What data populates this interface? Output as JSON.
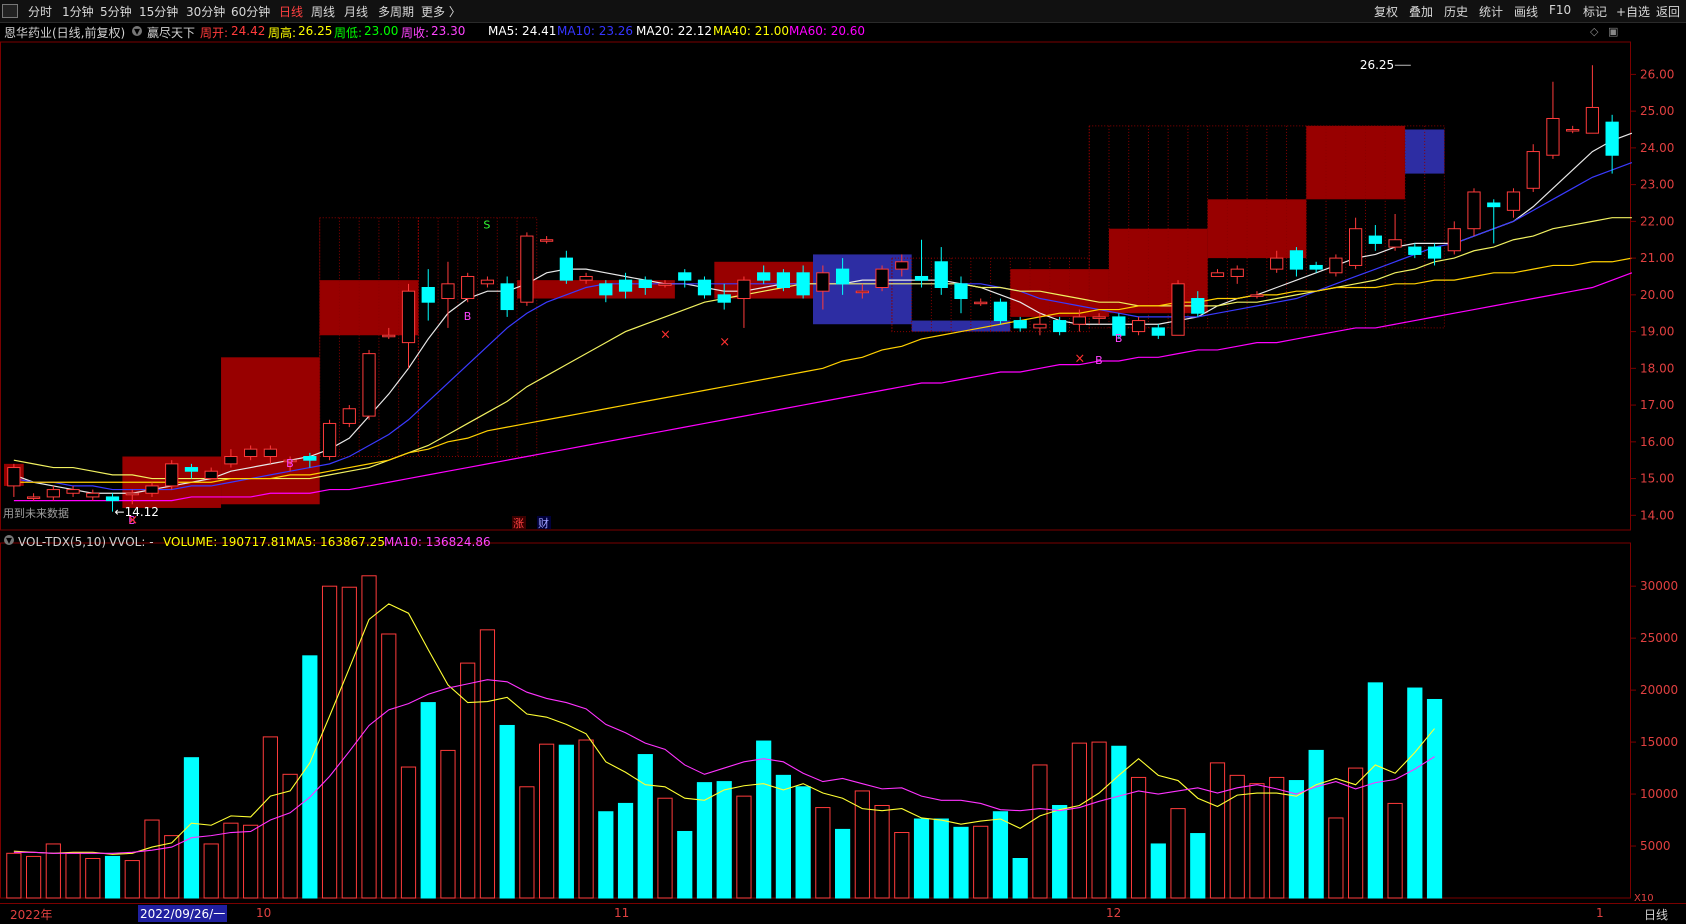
{
  "toolbar": {
    "periods": [
      "分时",
      "1分钟",
      "5分钟",
      "15分钟",
      "30分钟",
      "60分钟",
      "日线",
      "周线",
      "月线",
      "多周期",
      "更多 〉"
    ],
    "active_period": "日线",
    "right_buttons": [
      "复权",
      "叠加",
      "历史",
      "统计",
      "画线",
      "F10",
      "标记",
      "+自选",
      "返回"
    ]
  },
  "info": {
    "stock": "恩华药业(日线,前复权)",
    "indicator": "赢尽天下",
    "week_open_label": "周开:",
    "week_open": "24.42",
    "week_high_label": "周高:",
    "week_high": "26.25",
    "week_low_label": "周低:",
    "week_low": "23.00",
    "week_close_label": "周收:",
    "week_close": "23.30",
    "ma5": "MA5: 24.41",
    "ma10": "MA10: 23.26",
    "ma20": "MA20: 22.12",
    "ma40": "MA40: 21.00",
    "ma60": "MA60: 20.60"
  },
  "main_chart": {
    "y_ticks": [
      "26.00",
      "25.00",
      "24.00",
      "23.00",
      "22.00",
      "21.00",
      "20.00",
      "19.00",
      "18.00",
      "17.00",
      "16.00",
      "15.00",
      "14.00"
    ],
    "ymin": 13.6,
    "ymax": 26.8,
    "high_annotation": "26.25",
    "low_annotation": "←14.12",
    "future_data_note": "用到未来数据",
    "markers": [
      "涨",
      "财"
    ],
    "signals": {
      "buy": "B",
      "sell": "S",
      "cross": "×"
    },
    "candles": [
      [
        14.8,
        15.3,
        14.5,
        15.4
      ],
      [
        14.5,
        14.5,
        14.4,
        14.6
      ],
      [
        14.5,
        14.7,
        14.4,
        14.8
      ],
      [
        14.6,
        14.7,
        14.5,
        14.8
      ],
      [
        14.5,
        14.6,
        14.4,
        14.7
      ],
      [
        14.5,
        14.4,
        14.1,
        14.6
      ],
      [
        14.6,
        14.6,
        14.3,
        14.7
      ],
      [
        14.6,
        14.8,
        14.5,
        14.9
      ],
      [
        14.8,
        15.4,
        14.7,
        15.5
      ],
      [
        15.3,
        15.2,
        15.0,
        15.4
      ],
      [
        15.0,
        15.2,
        15.0,
        15.3
      ],
      [
        15.4,
        15.6,
        15.3,
        15.8
      ],
      [
        15.6,
        15.8,
        15.5,
        15.9
      ],
      [
        15.6,
        15.8,
        15.4,
        15.9
      ],
      [
        15.5,
        15.5,
        15.2,
        15.6
      ],
      [
        15.6,
        15.5,
        15.3,
        15.7
      ],
      [
        15.6,
        16.5,
        15.5,
        16.6
      ],
      [
        16.5,
        16.9,
        16.4,
        17.0
      ],
      [
        16.7,
        18.4,
        16.6,
        18.5
      ],
      [
        18.9,
        18.9,
        18.8,
        19.1
      ],
      [
        18.7,
        20.1,
        18.0,
        20.3
      ],
      [
        20.2,
        19.8,
        19.3,
        20.7
      ],
      [
        19.9,
        20.3,
        19.1,
        20.9
      ],
      [
        19.9,
        20.5,
        19.8,
        20.6
      ],
      [
        20.3,
        20.4,
        20.2,
        20.5
      ],
      [
        20.3,
        19.6,
        19.4,
        20.5
      ],
      [
        19.8,
        21.6,
        19.7,
        21.7
      ],
      [
        21.5,
        21.5,
        21.4,
        21.6
      ],
      [
        21.0,
        20.4,
        20.3,
        21.2
      ],
      [
        20.4,
        20.5,
        20.3,
        20.6
      ],
      [
        20.3,
        20.0,
        19.8,
        20.4
      ],
      [
        20.4,
        20.1,
        19.9,
        20.6
      ],
      [
        20.4,
        20.2,
        20.0,
        20.5
      ],
      [
        20.3,
        20.3,
        20.2,
        20.4
      ],
      [
        20.6,
        20.4,
        20.2,
        20.7
      ],
      [
        20.4,
        20.0,
        19.9,
        20.5
      ],
      [
        20.0,
        19.8,
        19.6,
        20.3
      ],
      [
        19.9,
        20.4,
        19.1,
        20.5
      ],
      [
        20.6,
        20.4,
        20.3,
        20.8
      ],
      [
        20.6,
        20.2,
        20.1,
        20.7
      ],
      [
        20.6,
        20.0,
        19.9,
        20.8
      ],
      [
        20.1,
        20.6,
        19.6,
        20.8
      ],
      [
        20.7,
        20.3,
        20.0,
        21.0
      ],
      [
        20.1,
        20.1,
        19.9,
        20.3
      ],
      [
        20.2,
        20.7,
        20.1,
        20.8
      ],
      [
        20.7,
        20.9,
        20.5,
        21.1
      ],
      [
        20.5,
        20.4,
        20.2,
        21.5
      ],
      [
        20.9,
        20.2,
        20.0,
        21.3
      ],
      [
        20.3,
        19.9,
        19.5,
        20.5
      ],
      [
        19.8,
        19.8,
        19.7,
        19.9
      ],
      [
        19.8,
        19.3,
        19.2,
        19.9
      ],
      [
        19.3,
        19.1,
        19.0,
        19.4
      ],
      [
        19.1,
        19.2,
        18.9,
        19.5
      ],
      [
        19.3,
        19.0,
        18.9,
        19.4
      ],
      [
        19.2,
        19.4,
        19.0,
        19.6
      ],
      [
        19.4,
        19.4,
        19.2,
        19.5
      ],
      [
        19.4,
        18.9,
        18.8,
        19.5
      ],
      [
        19.0,
        19.3,
        18.9,
        19.4
      ],
      [
        19.1,
        18.9,
        18.8,
        19.2
      ],
      [
        18.9,
        20.3,
        18.9,
        20.4
      ],
      [
        19.9,
        19.5,
        19.4,
        20.1
      ],
      [
        20.5,
        20.6,
        20.5,
        20.7
      ],
      [
        20.5,
        20.7,
        20.3,
        20.8
      ],
      [
        20.0,
        20.0,
        19.9,
        20.1
      ],
      [
        20.7,
        21.0,
        20.6,
        21.2
      ],
      [
        21.2,
        20.7,
        20.5,
        21.3
      ],
      [
        20.8,
        20.7,
        20.6,
        20.9
      ],
      [
        20.6,
        21.0,
        20.5,
        21.1
      ],
      [
        20.8,
        21.8,
        20.7,
        22.1
      ],
      [
        21.6,
        21.4,
        21.2,
        21.9
      ],
      [
        21.3,
        21.5,
        21.2,
        22.2
      ],
      [
        21.3,
        21.1,
        21.0,
        21.4
      ],
      [
        21.3,
        21.0,
        20.8,
        21.4
      ],
      [
        21.2,
        21.8,
        21.1,
        22.0
      ],
      [
        21.8,
        22.8,
        21.6,
        22.9
      ],
      [
        22.5,
        22.4,
        21.4,
        22.6
      ],
      [
        22.3,
        22.8,
        22.1,
        22.9
      ],
      [
        22.9,
        23.9,
        22.8,
        24.1
      ],
      [
        23.8,
        24.8,
        23.7,
        25.8
      ],
      [
        24.5,
        24.5,
        24.4,
        24.6
      ],
      [
        24.4,
        25.1,
        24.4,
        26.25
      ],
      [
        24.7,
        23.8,
        23.3,
        24.9
      ]
    ],
    "ma_lines": {
      "ma5": [
        15.1,
        14.9,
        14.8,
        14.7,
        14.6,
        14.6,
        14.6,
        14.7,
        14.8,
        14.9,
        15.0,
        15.2,
        15.3,
        15.4,
        15.5,
        15.6,
        15.8,
        16.1,
        16.7,
        17.3,
        18.0,
        18.8,
        19.5,
        19.9,
        20.1,
        20.1,
        20.3,
        20.6,
        20.7,
        20.7,
        20.6,
        20.5,
        20.4,
        20.3,
        20.3,
        20.2,
        20.1,
        20.1,
        20.2,
        20.3,
        20.3,
        20.3,
        20.3,
        20.4,
        20.4,
        20.4,
        20.4,
        20.4,
        20.3,
        20.2,
        20.0,
        19.8,
        19.5,
        19.3,
        19.2,
        19.2,
        19.2,
        19.2,
        19.2,
        19.3,
        19.4,
        19.7,
        19.9,
        20.0,
        20.2,
        20.4,
        20.6,
        20.8,
        21.0,
        21.1,
        21.3,
        21.4,
        21.4,
        21.4,
        21.6,
        21.8,
        22.0,
        22.4,
        22.9,
        23.4,
        23.9,
        24.2,
        24.4
      ],
      "ma10": [
        15.0,
        14.9,
        14.9,
        14.8,
        14.8,
        14.7,
        14.7,
        14.7,
        14.7,
        14.8,
        14.8,
        14.9,
        15.0,
        15.1,
        15.2,
        15.3,
        15.4,
        15.6,
        15.9,
        16.2,
        16.6,
        17.1,
        17.6,
        18.1,
        18.6,
        19.1,
        19.5,
        19.8,
        20.0,
        20.2,
        20.3,
        20.3,
        20.3,
        20.3,
        20.3,
        20.3,
        20.3,
        20.3,
        20.3,
        20.3,
        20.3,
        20.3,
        20.3,
        20.3,
        20.3,
        20.3,
        20.3,
        20.3,
        20.3,
        20.3,
        20.2,
        20.1,
        19.9,
        19.8,
        19.7,
        19.6,
        19.5,
        19.4,
        19.4,
        19.4,
        19.4,
        19.5,
        19.6,
        19.7,
        19.8,
        19.9,
        20.1,
        20.3,
        20.5,
        20.7,
        20.9,
        21.1,
        21.3,
        21.4,
        21.6,
        21.8,
        22.0,
        22.3,
        22.6,
        22.9,
        23.2,
        23.4,
        23.6
      ],
      "ma20": [
        15.5,
        15.4,
        15.3,
        15.3,
        15.2,
        15.1,
        15.1,
        15.0,
        15.0,
        15.0,
        15.0,
        15.0,
        15.0,
        15.0,
        15.0,
        15.0,
        15.1,
        15.2,
        15.3,
        15.5,
        15.7,
        15.9,
        16.2,
        16.5,
        16.8,
        17.1,
        17.5,
        17.8,
        18.1,
        18.4,
        18.7,
        19.0,
        19.2,
        19.4,
        19.6,
        19.8,
        19.9,
        20.0,
        20.1,
        20.2,
        20.3,
        20.3,
        20.3,
        20.3,
        20.3,
        20.3,
        20.3,
        20.3,
        20.3,
        20.2,
        20.2,
        20.1,
        20.1,
        20.0,
        19.9,
        19.8,
        19.8,
        19.7,
        19.7,
        19.7,
        19.7,
        19.7,
        19.8,
        19.8,
        19.9,
        20.0,
        20.1,
        20.2,
        20.3,
        20.4,
        20.6,
        20.7,
        20.9,
        21.0,
        21.2,
        21.3,
        21.5,
        21.6,
        21.8,
        21.9,
        22.0,
        22.1,
        22.1
      ],
      "ma40": [
        14.9,
        14.9,
        14.9,
        14.9,
        14.9,
        14.9,
        14.9,
        14.9,
        14.9,
        14.9,
        14.9,
        15.0,
        15.0,
        15.0,
        15.1,
        15.1,
        15.2,
        15.3,
        15.4,
        15.5,
        15.7,
        15.8,
        16.0,
        16.1,
        16.3,
        16.4,
        16.5,
        16.6,
        16.7,
        16.8,
        16.9,
        17.0,
        17.1,
        17.2,
        17.3,
        17.4,
        17.5,
        17.6,
        17.7,
        17.8,
        17.9,
        18.0,
        18.2,
        18.3,
        18.5,
        18.6,
        18.8,
        18.9,
        19.0,
        19.1,
        19.2,
        19.3,
        19.4,
        19.5,
        19.5,
        19.6,
        19.6,
        19.7,
        19.7,
        19.8,
        19.8,
        19.9,
        19.9,
        20.0,
        20.0,
        20.1,
        20.1,
        20.2,
        20.2,
        20.2,
        20.3,
        20.3,
        20.4,
        20.4,
        20.5,
        20.6,
        20.6,
        20.7,
        20.8,
        20.8,
        20.9,
        20.9,
        21.0
      ],
      "ma60": [
        14.4,
        14.4,
        14.4,
        14.4,
        14.4,
        14.4,
        14.4,
        14.4,
        14.4,
        14.5,
        14.5,
        14.5,
        14.5,
        14.6,
        14.6,
        14.6,
        14.7,
        14.7,
        14.8,
        14.9,
        15.0,
        15.1,
        15.2,
        15.3,
        15.4,
        15.5,
        15.6,
        15.7,
        15.8,
        15.9,
        16.0,
        16.1,
        16.2,
        16.3,
        16.4,
        16.5,
        16.6,
        16.7,
        16.8,
        16.9,
        17.0,
        17.1,
        17.2,
        17.3,
        17.4,
        17.5,
        17.6,
        17.6,
        17.7,
        17.8,
        17.9,
        17.9,
        18.0,
        18.1,
        18.1,
        18.2,
        18.2,
        18.3,
        18.3,
        18.4,
        18.5,
        18.5,
        18.6,
        18.7,
        18.7,
        18.8,
        18.9,
        19.0,
        19.1,
        19.1,
        19.2,
        19.3,
        19.4,
        19.5,
        19.6,
        19.7,
        19.8,
        19.9,
        20.0,
        20.1,
        20.2,
        20.4,
        20.6
      ]
    },
    "weekly_boxes": [
      {
        "from": 0,
        "to": 0,
        "open": 14.8,
        "close": 15.4
      },
      {
        "from": 6,
        "to": 10,
        "open": 14.2,
        "close": 15.6
      },
      {
        "from": 11,
        "to": 15,
        "open": 14.3,
        "close": 18.3
      },
      {
        "from": 16,
        "to": 20,
        "open": 18.9,
        "close": 20.4
      },
      {
        "from": 26,
        "to": 33,
        "open": 19.9,
        "close": 20.4
      },
      {
        "from": 36,
        "to": 40,
        "open": 19.9,
        "close": 20.9
      },
      {
        "from": 41,
        "to": 45,
        "open": 21.1,
        "close": 19.2
      },
      {
        "from": 46,
        "to": 50,
        "open": 19.3,
        "close": 19.0
      },
      {
        "from": 51,
        "to": 55,
        "open": 19.4,
        "close": 20.7
      },
      {
        "from": 56,
        "to": 60,
        "open": 19.5,
        "close": 21.8
      },
      {
        "from": 61,
        "to": 65,
        "open": 21.0,
        "close": 22.6
      },
      {
        "from": 66,
        "to": 70,
        "open": 22.6,
        "close": 24.6
      },
      {
        "from": 71,
        "to": 72,
        "open": 24.5,
        "close": 23.3
      }
    ]
  },
  "volume_panel": {
    "title": "VOL-TDX(5,10)",
    "vvol": "VVOL: -",
    "volume": "VOLUME: 190717.81",
    "ma5": "MA5: 163867.25",
    "ma10": "MA10: 136824.86",
    "y_ticks": [
      "30000",
      "25000",
      "20000",
      "15000",
      "10000",
      "5000"
    ],
    "ymax": 33000,
    "unit": "X10",
    "volumes": [
      4300,
      4000,
      5200,
      4300,
      3800,
      4000,
      3600,
      7500,
      6000,
      13500,
      5200,
      7200,
      7000,
      15500,
      11900,
      23300,
      30000,
      29900,
      31000,
      25400,
      12600,
      18800,
      14200,
      22600,
      25800,
      16600,
      10700,
      14800,
      14700,
      15200,
      8300,
      9100,
      13800,
      9600,
      6400,
      11100,
      11200,
      9800,
      15100,
      11800,
      10700,
      8700,
      6600,
      10300,
      8900,
      6300,
      7600,
      7600,
      6800,
      6900,
      8300,
      3800,
      12800,
      8900,
      14900,
      15000,
      14600,
      11600,
      5200,
      8600,
      6200,
      13000,
      11800,
      11000,
      11600,
      11300,
      14200,
      7700,
      12500,
      20700,
      9100,
      20200,
      19100
    ],
    "vol_ma5": [
      4500,
      4400,
      4300,
      4400,
      4400,
      4200,
      4300,
      4900,
      5300,
      7200,
      7000,
      7900,
      7800,
      9800,
      10300,
      13000,
      17500,
      22100,
      26800,
      28300,
      27400,
      23900,
      20500,
      18800,
      18900,
      19300,
      17700,
      17400,
      16700,
      15800,
      13100,
      12100,
      10900,
      10700,
      9600,
      9400,
      10400,
      10800,
      11000,
      10400,
      11000,
      10100,
      9600,
      8600,
      8400,
      8600,
      7700,
      7500,
      7100,
      7400,
      7600,
      6700,
      7900,
      8500,
      8900,
      10100,
      11800,
      13400,
      11800,
      11300,
      9600,
      8800,
      9900,
      10100,
      10100,
      9800,
      10900,
      11500,
      10900,
      12800,
      12000,
      14000,
      16300
    ],
    "vol_ma10": [
      4400,
      4400,
      4300,
      4300,
      4300,
      4300,
      4400,
      4600,
      4900,
      5800,
      6000,
      6300,
      6400,
      7500,
      8200,
      9700,
      11700,
      14100,
      16600,
      18100,
      18700,
      19600,
      20200,
      20600,
      21000,
      20800,
      19800,
      19200,
      18800,
      18200,
      16700,
      15900,
      14900,
      14300,
      12800,
      11900,
      12500,
      13100,
      13400,
      13100,
      12000,
      11200,
      11500,
      11000,
      10500,
      10600,
      9800,
      9400,
      9400,
      9100,
      8500,
      8400,
      8600,
      8400,
      8700,
      9300,
      9800,
      10300,
      10000,
      10300,
      10600,
      10100,
      10600,
      10900,
      10500,
      10000,
      10700,
      11200,
      10500,
      11100,
      11400,
      12400,
      13600
    ]
  },
  "bottom_axis": {
    "labels": [
      "2022年",
      "2022/09/26/一",
      "10",
      "11",
      "12",
      "1"
    ],
    "period": "日线"
  },
  "colors": {
    "up": "#ff3b3b",
    "down": "#00ffff",
    "grid": "#7a0000",
    "ma5": "#ffffff",
    "ma10": "#2727ff",
    "ma20": "#ffff00",
    "ma40": "#ffea00",
    "ma60": "#ff00ff",
    "up_box": "#b30000",
    "down_box": "#3535c0"
  }
}
